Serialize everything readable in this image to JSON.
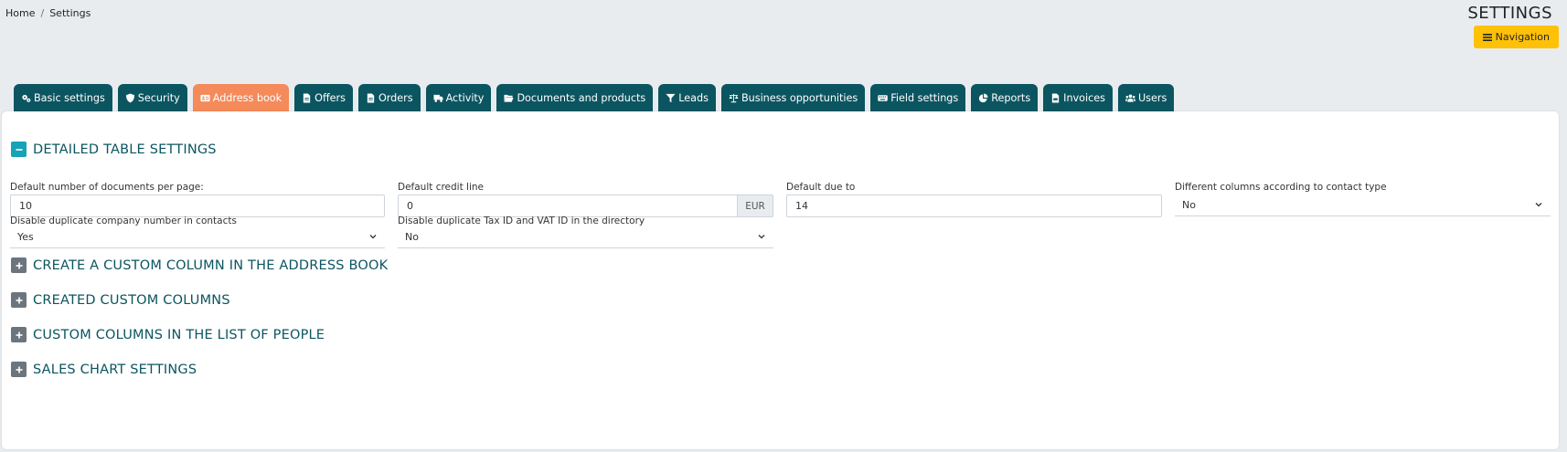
{
  "breadcrumb": {
    "home": "Home",
    "separator": "/",
    "current": "Settings"
  },
  "header": {
    "title": "SETTINGS",
    "nav_button": "Navigation"
  },
  "tabs": [
    {
      "label": "Basic settings",
      "icon": "cogs-icon"
    },
    {
      "label": "Security",
      "icon": "shield-icon"
    },
    {
      "label": "Address book",
      "icon": "address-card-icon",
      "active": true
    },
    {
      "label": "Offers",
      "icon": "file-icon"
    },
    {
      "label": "Orders",
      "icon": "file-icon"
    },
    {
      "label": "Activity",
      "icon": "truck-icon"
    },
    {
      "label": "Documents and products",
      "icon": "folder-open-icon"
    },
    {
      "label": "Leads",
      "icon": "filter-icon"
    },
    {
      "label": "Business opportunities",
      "icon": "balance-scale-icon"
    },
    {
      "label": "Field settings",
      "icon": "keyboard-icon"
    },
    {
      "label": "Reports",
      "icon": "pie-chart-icon"
    },
    {
      "label": "Invoices",
      "icon": "file-invoice-icon"
    },
    {
      "label": "Users",
      "icon": "users-icon"
    }
  ],
  "sections": {
    "detailed": {
      "title": "DETAILED TABLE SETTINGS",
      "expanded": true
    },
    "create_custom": {
      "title": "CREATE A CUSTOM COLUMN IN THE ADDRESS BOOK"
    },
    "created_custom": {
      "title": "CREATED CUSTOM COLUMNS"
    },
    "people_columns": {
      "title": "CUSTOM COLUMNS IN THE LIST OF PEOPLE"
    },
    "sales_chart": {
      "title": "SALES CHART SETTINGS"
    }
  },
  "fields": {
    "docs_per_page": {
      "label": "Default number of documents per page:",
      "value": "10"
    },
    "credit_line": {
      "label": "Default credit line",
      "value": "0",
      "addon": "EUR"
    },
    "due_to": {
      "label": "Default due to",
      "value": "14"
    },
    "diff_columns": {
      "label": "Different columns according to contact type",
      "value": "No"
    },
    "dup_company": {
      "label": "Disable duplicate company number in contacts",
      "value": "Yes"
    },
    "dup_tax": {
      "label": "Disable duplicate Tax ID and VAT ID in the directory",
      "value": "No"
    }
  },
  "colors": {
    "tab_bg": "#0b5560",
    "tab_active": "#f58a5a",
    "nav_button": "#ffc107",
    "section_title": "#0b5560",
    "toggle_open": "#17a2b8",
    "toggle_closed": "#6c757d"
  }
}
